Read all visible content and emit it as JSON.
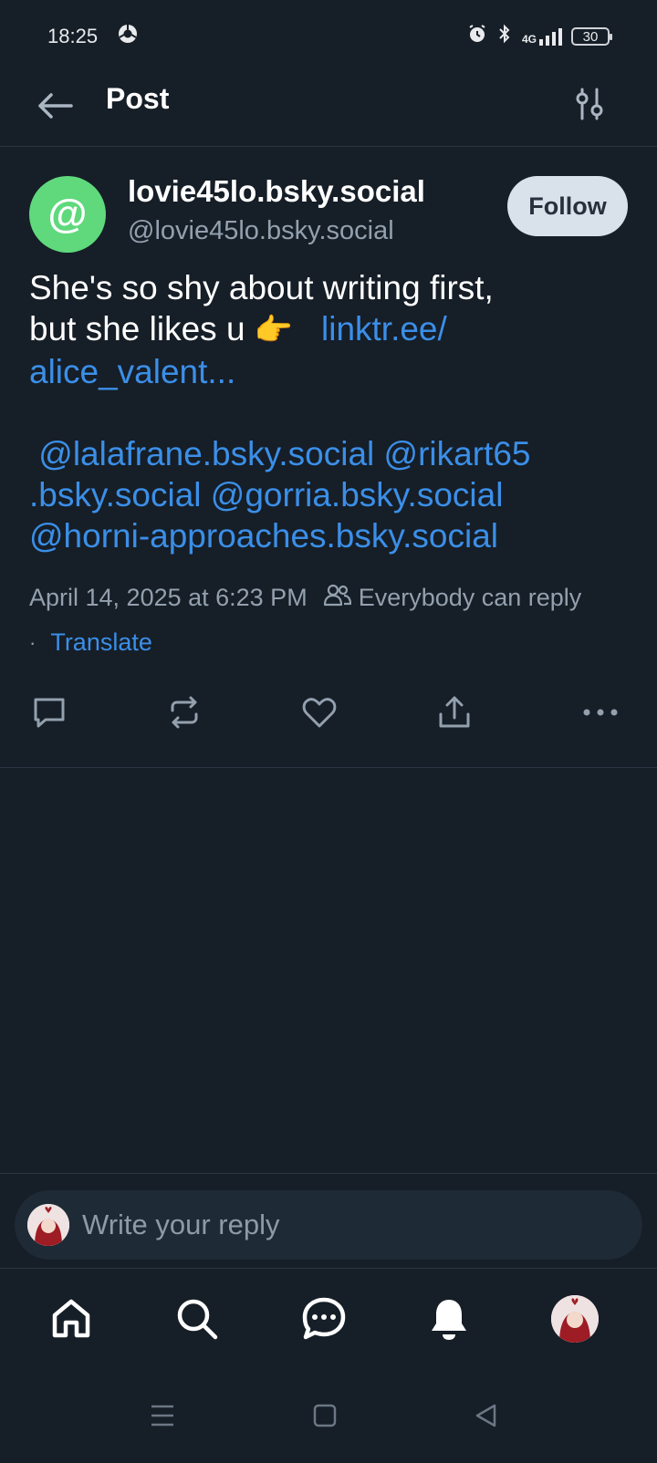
{
  "status_bar": {
    "time": "18:25",
    "battery": "30",
    "network": "4G",
    "icons": [
      "chrome-icon",
      "alarm-icon",
      "bluetooth-icon",
      "signal-icon",
      "battery-icon"
    ]
  },
  "header": {
    "title": "Post",
    "icons": [
      "back-arrow-icon",
      "filter-sliders-icon"
    ]
  },
  "post": {
    "avatar_glyph": "@",
    "display_name": "lovie45lo.bsky.social",
    "handle": "@lovie45lo.bsky.social",
    "follow_label": "Follow",
    "text_line1": "She's so shy about writing first,",
    "text_line2": "but she likes u ",
    "emoji": "👉",
    "link": "linktr.ee/\nalice_valent...",
    "mentions": [
      "@lalafrane.bsky.social",
      "@rikart65\n.bsky.social",
      "@gorria.bsky.social",
      "@horni-approaches.bsky.social"
    ],
    "timestamp": "April 14, 2025 at 6:23 PM",
    "reply_setting": "Everybody can reply",
    "dot": "·",
    "translate_label": "Translate",
    "actions": [
      "reply-icon",
      "repost-icon",
      "like-icon",
      "share-icon",
      "more-icon"
    ]
  },
  "reply_bar": {
    "placeholder": "Write your reply"
  },
  "tabs": [
    "home-icon",
    "search-icon",
    "chat-icon",
    "notifications-icon",
    "profile-avatar"
  ],
  "colors": {
    "background": "#161e27",
    "accent_link": "#3b8fe8",
    "avatar_green": "#5fd97c",
    "follow_button": "#d9e1ea",
    "muted_text": "#93a0ae"
  }
}
